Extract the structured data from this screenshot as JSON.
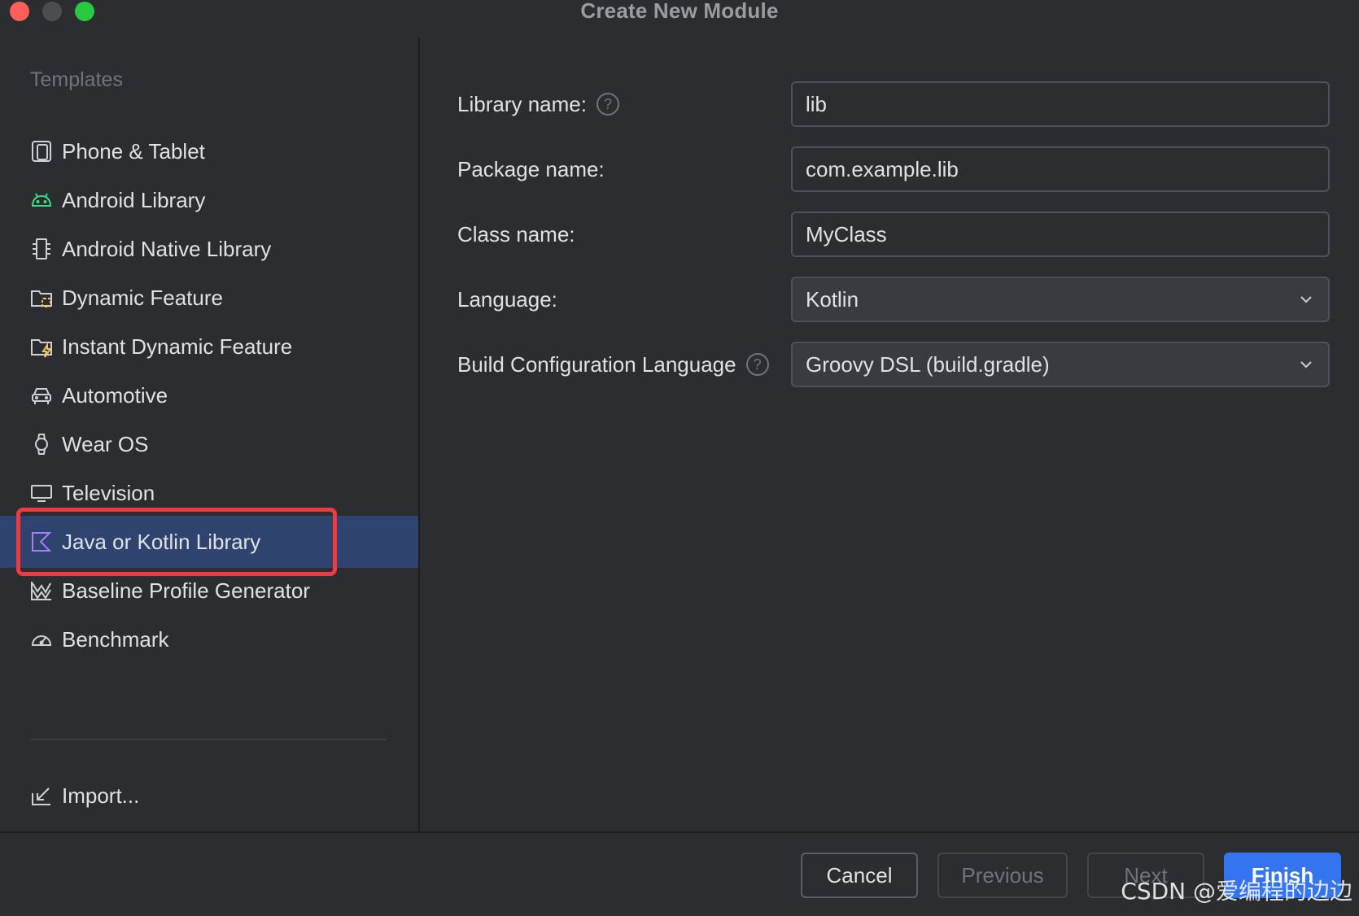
{
  "window": {
    "title": "Create New Module"
  },
  "sidebar": {
    "heading": "Templates",
    "items": [
      {
        "label": "Phone & Tablet",
        "icon": "phone-tablet-icon"
      },
      {
        "label": "Android Library",
        "icon": "android-icon"
      },
      {
        "label": "Android Native Library",
        "icon": "native-chip-icon"
      },
      {
        "label": "Dynamic Feature",
        "icon": "dynamic-feature-folder-icon"
      },
      {
        "label": "Instant Dynamic Feature",
        "icon": "instant-feature-folder-icon"
      },
      {
        "label": "Automotive",
        "icon": "car-icon"
      },
      {
        "label": "Wear OS",
        "icon": "watch-icon"
      },
      {
        "label": "Television",
        "icon": "tv-icon"
      },
      {
        "label": "Java or Kotlin Library",
        "icon": "kotlin-icon",
        "selected": true
      },
      {
        "label": "Baseline Profile Generator",
        "icon": "baseline-profile-icon"
      },
      {
        "label": "Benchmark",
        "icon": "gauge-icon"
      }
    ],
    "import_label": "Import..."
  },
  "form": {
    "library_name": {
      "label": "Library name:",
      "value": "lib"
    },
    "package_name": {
      "label": "Package name:",
      "value": "com.example.lib"
    },
    "class_name": {
      "label": "Class name:",
      "value": "MyClass"
    },
    "language": {
      "label": "Language:",
      "selected": "Kotlin"
    },
    "build_config": {
      "label": "Build Configuration Language",
      "selected": "Groovy DSL (build.gradle)"
    },
    "help_glyph": "?"
  },
  "footer": {
    "cancel": "Cancel",
    "previous": "Previous",
    "next": "Next",
    "finish": "Finish"
  },
  "watermark": "CSDN @爱编程的边边",
  "colors": {
    "background": "#2b2d30",
    "selection": "#2e436e",
    "accent": "#3574f0",
    "highlight": "#ef3a3f",
    "android_green": "#3ddc84",
    "kotlin_purple": "#a97bff"
  }
}
